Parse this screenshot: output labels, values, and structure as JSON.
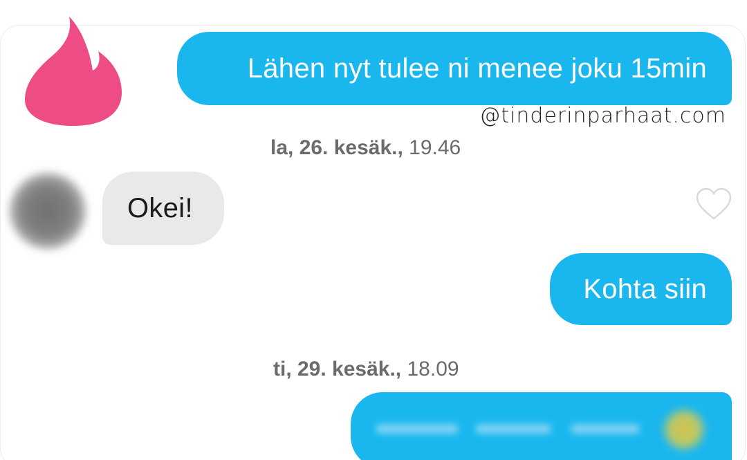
{
  "watermark": "@tinderinparhaat.com",
  "logo": {
    "icon": "tinder-flame-icon",
    "color": "#ee4c84"
  },
  "colors": {
    "sent_bubble": "#1ab7ef",
    "received_bubble": "#e9e9eb",
    "timestamp_text": "#6b6b6b"
  },
  "conversation": {
    "messages": [
      {
        "direction": "sent",
        "text": "Lähen nyt tulee ni menee joku 15min"
      },
      {
        "timestamp_day": "la, 26. kesäk.,",
        "timestamp_time": "19.46"
      },
      {
        "direction": "received",
        "text": "Okei!",
        "avatar": "blurred-avatar",
        "like_icon": "heart-outline-icon"
      },
      {
        "direction": "sent",
        "text": "Kohta siin"
      },
      {
        "timestamp_day": "ti, 29. kesäk.,",
        "timestamp_time": "18.09"
      },
      {
        "direction": "sent",
        "text": "",
        "blurred": true
      }
    ]
  }
}
